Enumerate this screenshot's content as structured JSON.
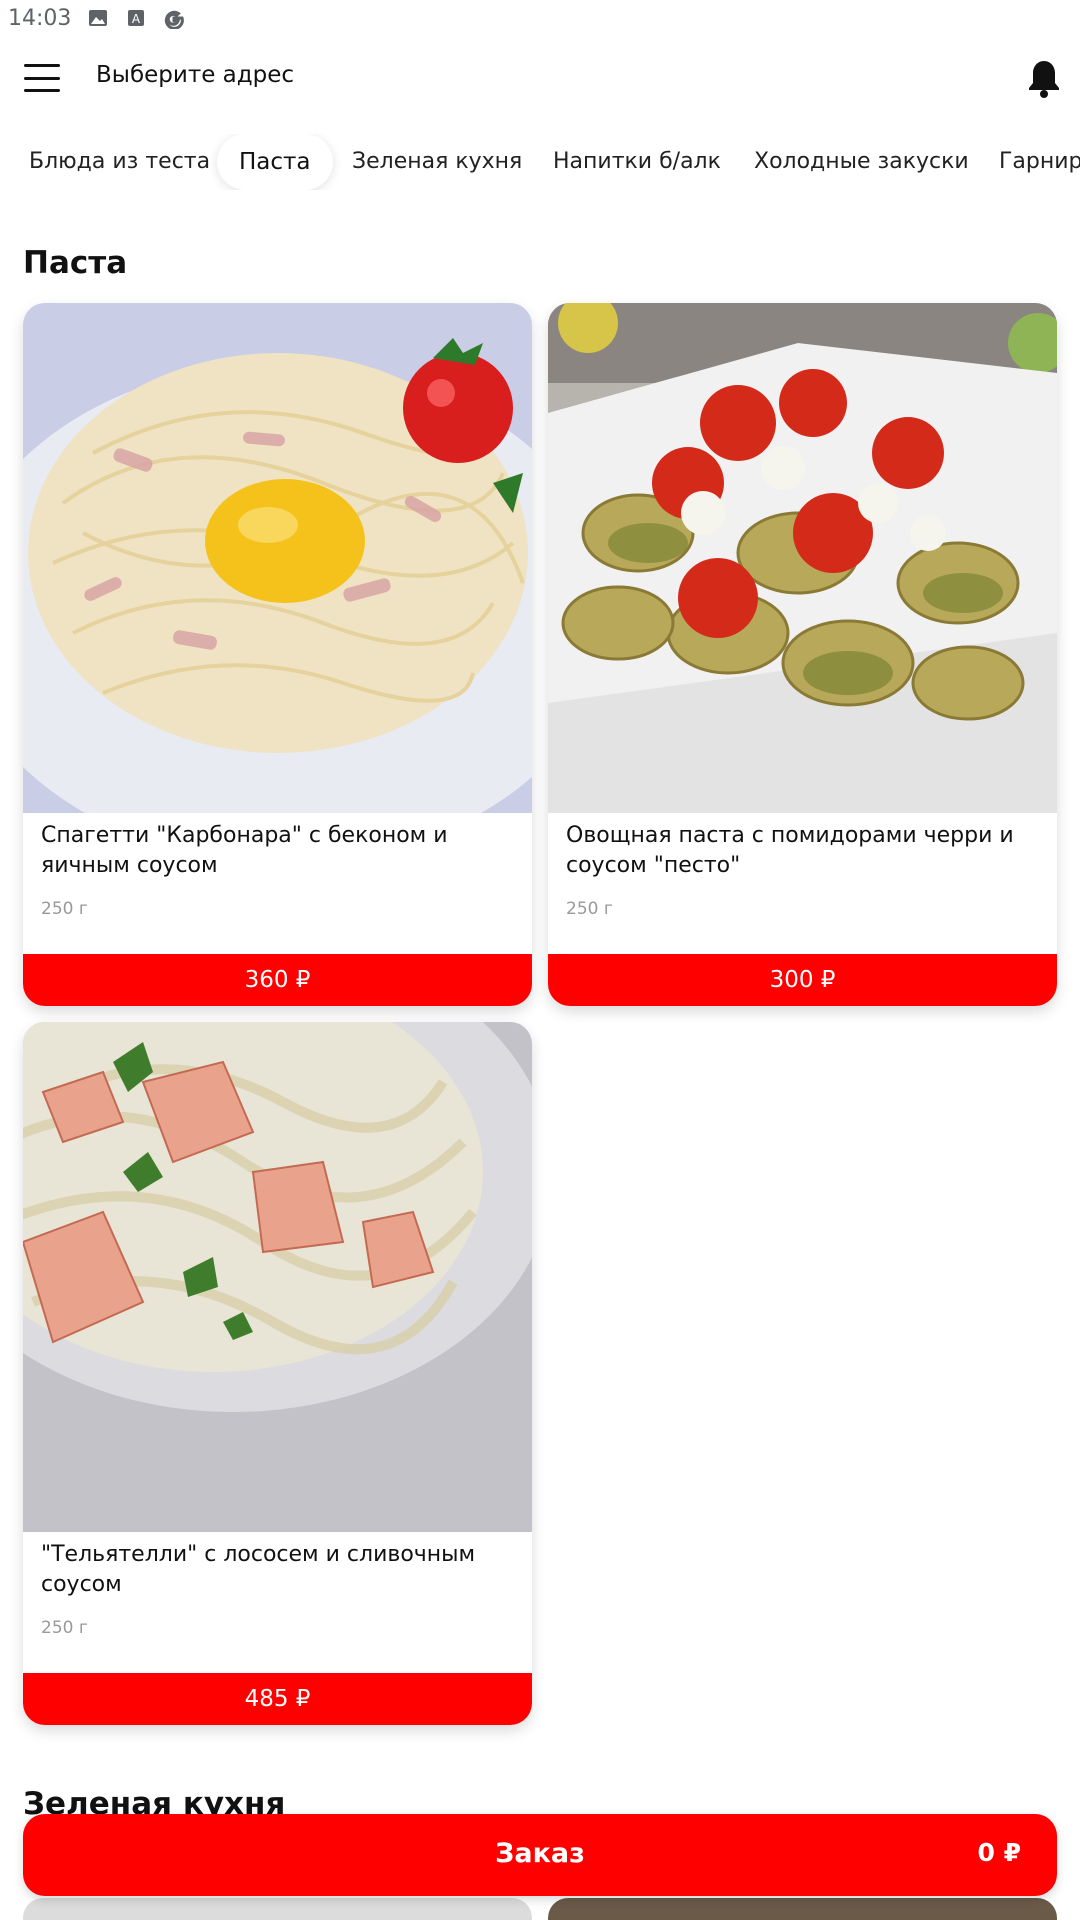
{
  "status_bar": {
    "time": "14:03",
    "icons": [
      "image-icon",
      "font-icon",
      "google-icon"
    ]
  },
  "header": {
    "address_prompt": "Выберите адрес",
    "menu_icon": "menu-icon",
    "notification_icon": "bell-icon"
  },
  "tabs": [
    {
      "label": "Блюда из теста",
      "active": false
    },
    {
      "label": "Паста",
      "active": true
    },
    {
      "label": "Зеленая кухня",
      "active": false
    },
    {
      "label": "Напитки б/алк",
      "active": false
    },
    {
      "label": "Холодные закуски",
      "active": false
    },
    {
      "label": "Гарнир",
      "active": false
    }
  ],
  "sections": [
    {
      "title": "Паста",
      "items": [
        {
          "name": "Спагетти \"Карбонара\" с беконом и яичным соусом",
          "weight": "250 г",
          "price": "360 ₽"
        },
        {
          "name": "Овощная паста с помидорами черри и соусом \"песто\"",
          "weight": "250 г",
          "price": "300 ₽"
        },
        {
          "name": "\"Тельятелли\" с лососем и сливочным соусом",
          "weight": "250 г",
          "price": "485 ₽"
        }
      ]
    },
    {
      "title": "Зеленая кухня"
    }
  ],
  "order_bar": {
    "label": "Заказ",
    "total": "0 ₽"
  },
  "colors": {
    "accent": "#ff0000",
    "text": "#111111",
    "muted": "#999999"
  }
}
